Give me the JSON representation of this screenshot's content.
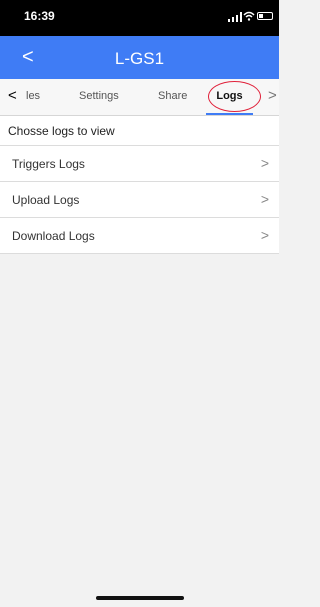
{
  "status_bar": {
    "time": "16:39",
    "icons": [
      "signal-icon",
      "wifi-icon",
      "battery-icon"
    ]
  },
  "nav": {
    "title": "L-GS1",
    "back_glyph": "<"
  },
  "tabs": {
    "left_arrow_glyph": "<",
    "right_arrow_glyph": ">",
    "items": [
      {
        "label": "les"
      },
      {
        "label": "Settings"
      },
      {
        "label": "Share"
      },
      {
        "label": "Logs",
        "active": true
      }
    ]
  },
  "content": {
    "header": "Chosse logs to view",
    "items": [
      {
        "label": "Triggers Logs"
      },
      {
        "label": "Upload Logs"
      },
      {
        "label": "Download Logs"
      }
    ],
    "chevron_glyph": ">"
  },
  "colors": {
    "accent": "#3f7cf5",
    "highlight": "#e0213a",
    "background": "#f2f2f2"
  }
}
